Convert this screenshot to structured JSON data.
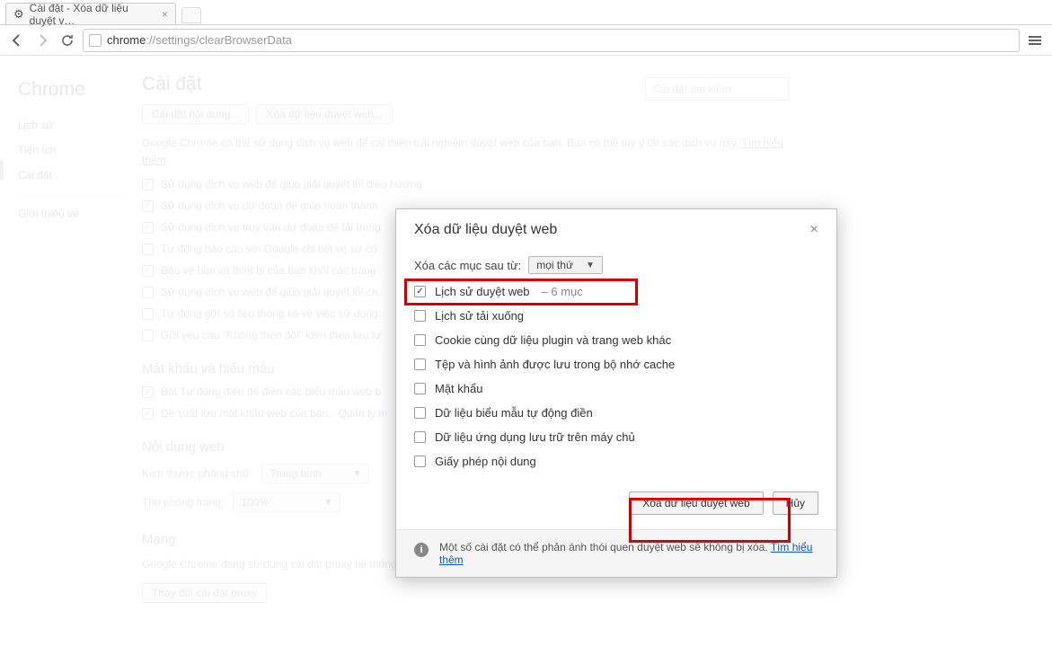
{
  "tab": {
    "title": "Cài đặt - Xóa dữ liệu duyệt v…"
  },
  "omnibox": {
    "scheme": "chrome",
    "host": "://settings",
    "path": "/clearBrowserData"
  },
  "sidebar": {
    "brand": "Chrome",
    "items": [
      "Lịch sử",
      "Tiện ích",
      "Cài đặt"
    ],
    "about": "Giới thiệu về"
  },
  "content": {
    "title": "Cài đặt",
    "btn_content": "Cài đặt nội dung...",
    "btn_cleardata": "Xóa dữ liệu duyệt web...",
    "search_placeholder": "Cài đặt tìm kiếm",
    "desc1": "Google Chrome có thể sử dụng dịch vụ web để cải thiện trải nghiệm duyệt web của bạn. Bạn có thể tùy ý tắt các dịch vụ này.",
    "learn_more": "Tìm hiểu thêm",
    "checks": [
      {
        "on": true,
        "label": "Sử dụng dịch vụ web để giúp giải quyết lỗi điều hướng"
      },
      {
        "on": true,
        "label": "Sử dụng dịch vụ dự đoán để giúp hoàn thành"
      },
      {
        "on": true,
        "label": "Sử dụng dịch vụ truy vấn dự đoán để tải trang"
      },
      {
        "on": false,
        "label": "Tự động báo cáo với Google chi tiết về sự cố"
      },
      {
        "on": true,
        "label": "Bảo vệ bạn và thiết bị của bạn khỏi các trang"
      },
      {
        "on": false,
        "label": "Sử dụng dịch vụ web để giúp giải quyết lỗi ch"
      },
      {
        "on": false,
        "label": "Tự động gửi số liệu thống kê về việc sử dụng"
      },
      {
        "on": false,
        "label": "Gửi yêu cầu \"Không theo dõi\" kèm theo lưu lư"
      }
    ],
    "section_pw": "Mật khẩu và biểu mẫu",
    "pw_checks": [
      {
        "on": true,
        "label": "Bật Tự động điền để điền các biểu mẫu web b"
      },
      {
        "on": true,
        "label": "Đề xuất lưu mật khẩu web của bạn.",
        "link": "Quản lý m"
      }
    ],
    "section_web": "Nội dung web",
    "font_label": "Kích thước phông chữ:",
    "font_value": "Trung bình",
    "zoom_label": "Thu phóng trang:",
    "zoom_value": "100%",
    "section_net": "Mạng",
    "net_desc": "Google Chrome đang sử dụng cài đặt proxy hệ thống trên máy tính của bạn để kết nối mạng.",
    "btn_proxy": "Thay đổi cài đặt proxy"
  },
  "modal": {
    "title": "Xóa dữ liệu duyệt web",
    "from_label": "Xóa các mục sau từ:",
    "from_value": "mọi thứ",
    "options": [
      {
        "on": true,
        "label": "Lịch sử duyệt web",
        "extra": "– 6 mục"
      },
      {
        "on": false,
        "label": "Lịch sử tải xuống"
      },
      {
        "on": false,
        "label": "Cookie cùng dữ liệu plugin và trang web khác"
      },
      {
        "on": false,
        "label": "Tệp và hình ảnh được lưu trong bộ nhớ cache"
      },
      {
        "on": false,
        "label": "Mật khẩu"
      },
      {
        "on": false,
        "label": "Dữ liệu biểu mẫu tự động điền"
      },
      {
        "on": false,
        "label": "Dữ liệu ứng dụng lưu trữ trên máy chủ"
      },
      {
        "on": false,
        "label": "Giấy phép nội dung"
      }
    ],
    "clear_btn": "Xóa dữ liệu duyệt web",
    "cancel_btn": "Hủy",
    "foot_text": "Một số cài đặt có thể phản ánh thói quen duyệt web sẽ không bị xóa.",
    "foot_link": "Tìm hiểu thêm"
  }
}
